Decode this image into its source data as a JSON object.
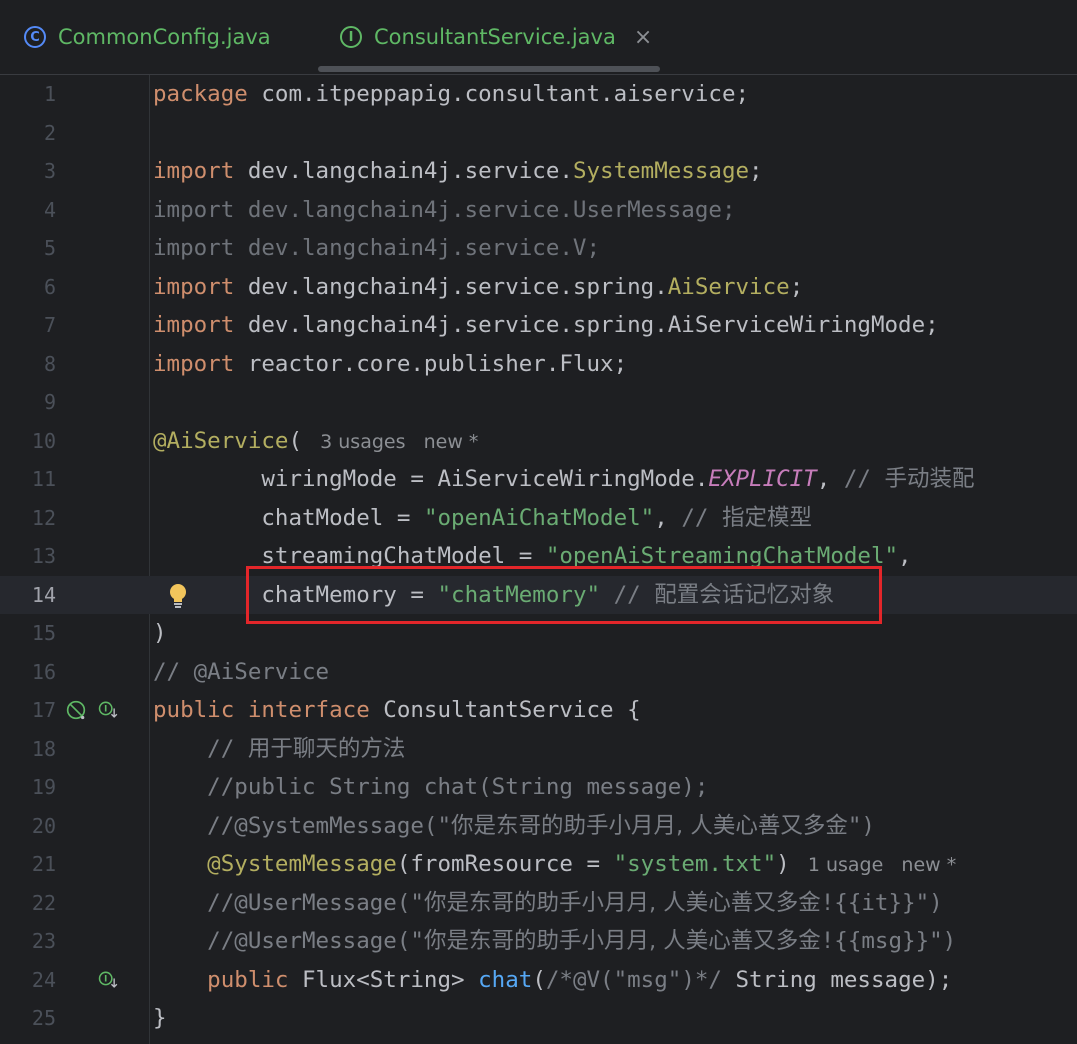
{
  "tabs": [
    {
      "label": "CommonConfig.java",
      "icon": "C",
      "icon_name": "java-class-icon"
    },
    {
      "label": "ConsultantService.java",
      "icon": "I",
      "icon_name": "java-interface-icon",
      "active": true,
      "close": "×"
    }
  ],
  "active_line": 14,
  "lines": [
    {
      "n": "1",
      "segs": [
        [
          "kw",
          "package"
        ],
        [
          "",
          "com.itpeppapig.consultant.aiservice;"
        ]
      ]
    },
    {
      "n": "2",
      "segs": []
    },
    {
      "n": "3",
      "segs": [
        [
          "kw",
          "import"
        ],
        [
          "",
          "dev.langchain4j.service."
        ],
        [
          "ann",
          "SystemMessage"
        ],
        [
          "",
          ";"
        ]
      ]
    },
    {
      "n": "4",
      "segs": [
        [
          "unused",
          "import dev.langchain4j.service.UserMessage;"
        ]
      ]
    },
    {
      "n": "5",
      "segs": [
        [
          "unused",
          "import dev.langchain4j.service.V;"
        ]
      ]
    },
    {
      "n": "6",
      "segs": [
        [
          "kw",
          "import"
        ],
        [
          "",
          "dev.langchain4j.service.spring."
        ],
        [
          "ann",
          "AiService"
        ],
        [
          "",
          ";"
        ]
      ]
    },
    {
      "n": "7",
      "segs": [
        [
          "kw",
          "import"
        ],
        [
          "",
          "dev.langchain4j.service.spring.AiServiceWiringMode;"
        ]
      ]
    },
    {
      "n": "8",
      "segs": [
        [
          "kw",
          "import"
        ],
        [
          "",
          "reactor.core.publisher.Flux;"
        ]
      ]
    },
    {
      "n": "9",
      "segs": []
    },
    {
      "n": "10",
      "segs": [
        [
          "ann",
          "@AiService"
        ],
        [
          "",
          "("
        ]
      ],
      "hint": "3 usages   new *"
    },
    {
      "n": "11",
      "segs": [
        [
          "",
          "        wiringMode = AiServiceWiringMode."
        ],
        [
          "const",
          "EXPLICIT"
        ],
        [
          "",
          ", "
        ],
        [
          "cmt",
          "// "
        ],
        [
          "cmt cjk",
          "手动装配"
        ]
      ]
    },
    {
      "n": "12",
      "segs": [
        [
          "",
          "        chatModel = "
        ],
        [
          "str",
          "\"openAiChatModel\""
        ],
        [
          "",
          ", "
        ],
        [
          "cmt",
          "// "
        ],
        [
          "cmt cjk",
          "指定模型"
        ]
      ]
    },
    {
      "n": "13",
      "segs": [
        [
          "",
          "        streamingChatModel = "
        ],
        [
          "str",
          "\"openAiStreamingChatModel\""
        ],
        [
          "",
          ","
        ]
      ]
    },
    {
      "n": "14",
      "segs": [
        [
          "",
          "        chatMemory = "
        ],
        [
          "str",
          "\"chatMemory\""
        ],
        [
          "cmt",
          " // "
        ],
        [
          "cmt cjk",
          "配置会话记忆对象"
        ]
      ]
    },
    {
      "n": "15",
      "segs": [
        [
          "",
          ")"
        ]
      ]
    },
    {
      "n": "16",
      "segs": [
        [
          "cmt",
          "// @AiService"
        ]
      ]
    },
    {
      "n": "17",
      "segs": [
        [
          "kw",
          "public interface"
        ],
        [
          "",
          " ConsultantService {"
        ]
      ]
    },
    {
      "n": "18",
      "segs": [
        [
          "cmt",
          "    // "
        ],
        [
          "cmt cjk",
          "用于聊天的方法"
        ]
      ]
    },
    {
      "n": "19",
      "segs": [
        [
          "cmt",
          "    //public String chat(String message);"
        ]
      ]
    },
    {
      "n": "20",
      "segs": [
        [
          "cmt",
          "    //@SystemMessage(\""
        ],
        [
          "cmt cjk",
          "你是东哥的助手小月月, 人美心善又多金"
        ],
        [
          "cmt",
          "\")"
        ]
      ]
    },
    {
      "n": "21",
      "segs": [
        [
          "ann",
          "    @SystemMessage"
        ],
        [
          "",
          "(fromResource = "
        ],
        [
          "str",
          "\"system.txt\""
        ],
        [
          "",
          ")"
        ]
      ],
      "hint": "1 usage   new *"
    },
    {
      "n": "22",
      "segs": [
        [
          "cmt",
          "    //@UserMessage(\""
        ],
        [
          "cmt cjk",
          "你是东哥的助手小月月, 人美心善又多金"
        ],
        [
          "cmt",
          "!{{it}}\")"
        ]
      ]
    },
    {
      "n": "23",
      "segs": [
        [
          "cmt",
          "    //@UserMessage(\""
        ],
        [
          "cmt cjk",
          "你是东哥的助手小月月, 人美心善又多金"
        ],
        [
          "cmt",
          "!{{msg}}\")"
        ]
      ]
    },
    {
      "n": "24",
      "segs": [
        [
          "kw",
          "    public"
        ],
        [
          "",
          " Flux<String> "
        ],
        [
          "fn",
          "chat"
        ],
        [
          "",
          "("
        ],
        [
          "cmt",
          "/*@V(\"msg\")*/"
        ],
        [
          "",
          " String message);"
        ]
      ]
    },
    {
      "n": "25",
      "segs": [
        [
          "",
          "}"
        ]
      ]
    }
  ],
  "gutter_icons": [
    {
      "line": "14",
      "name": "lightbulb-icon"
    },
    {
      "line": "17",
      "name": "no-implementations-icon"
    },
    {
      "line": "17",
      "name": "implemented-interface-icon"
    },
    {
      "line": "24",
      "name": "implemented-method-icon"
    }
  ],
  "colors": {
    "keyword": "#cf8e6d",
    "string": "#6aab73",
    "annotation": "#b3ae60",
    "comment": "#7a7e85",
    "highlight_box": "#e3262a"
  }
}
